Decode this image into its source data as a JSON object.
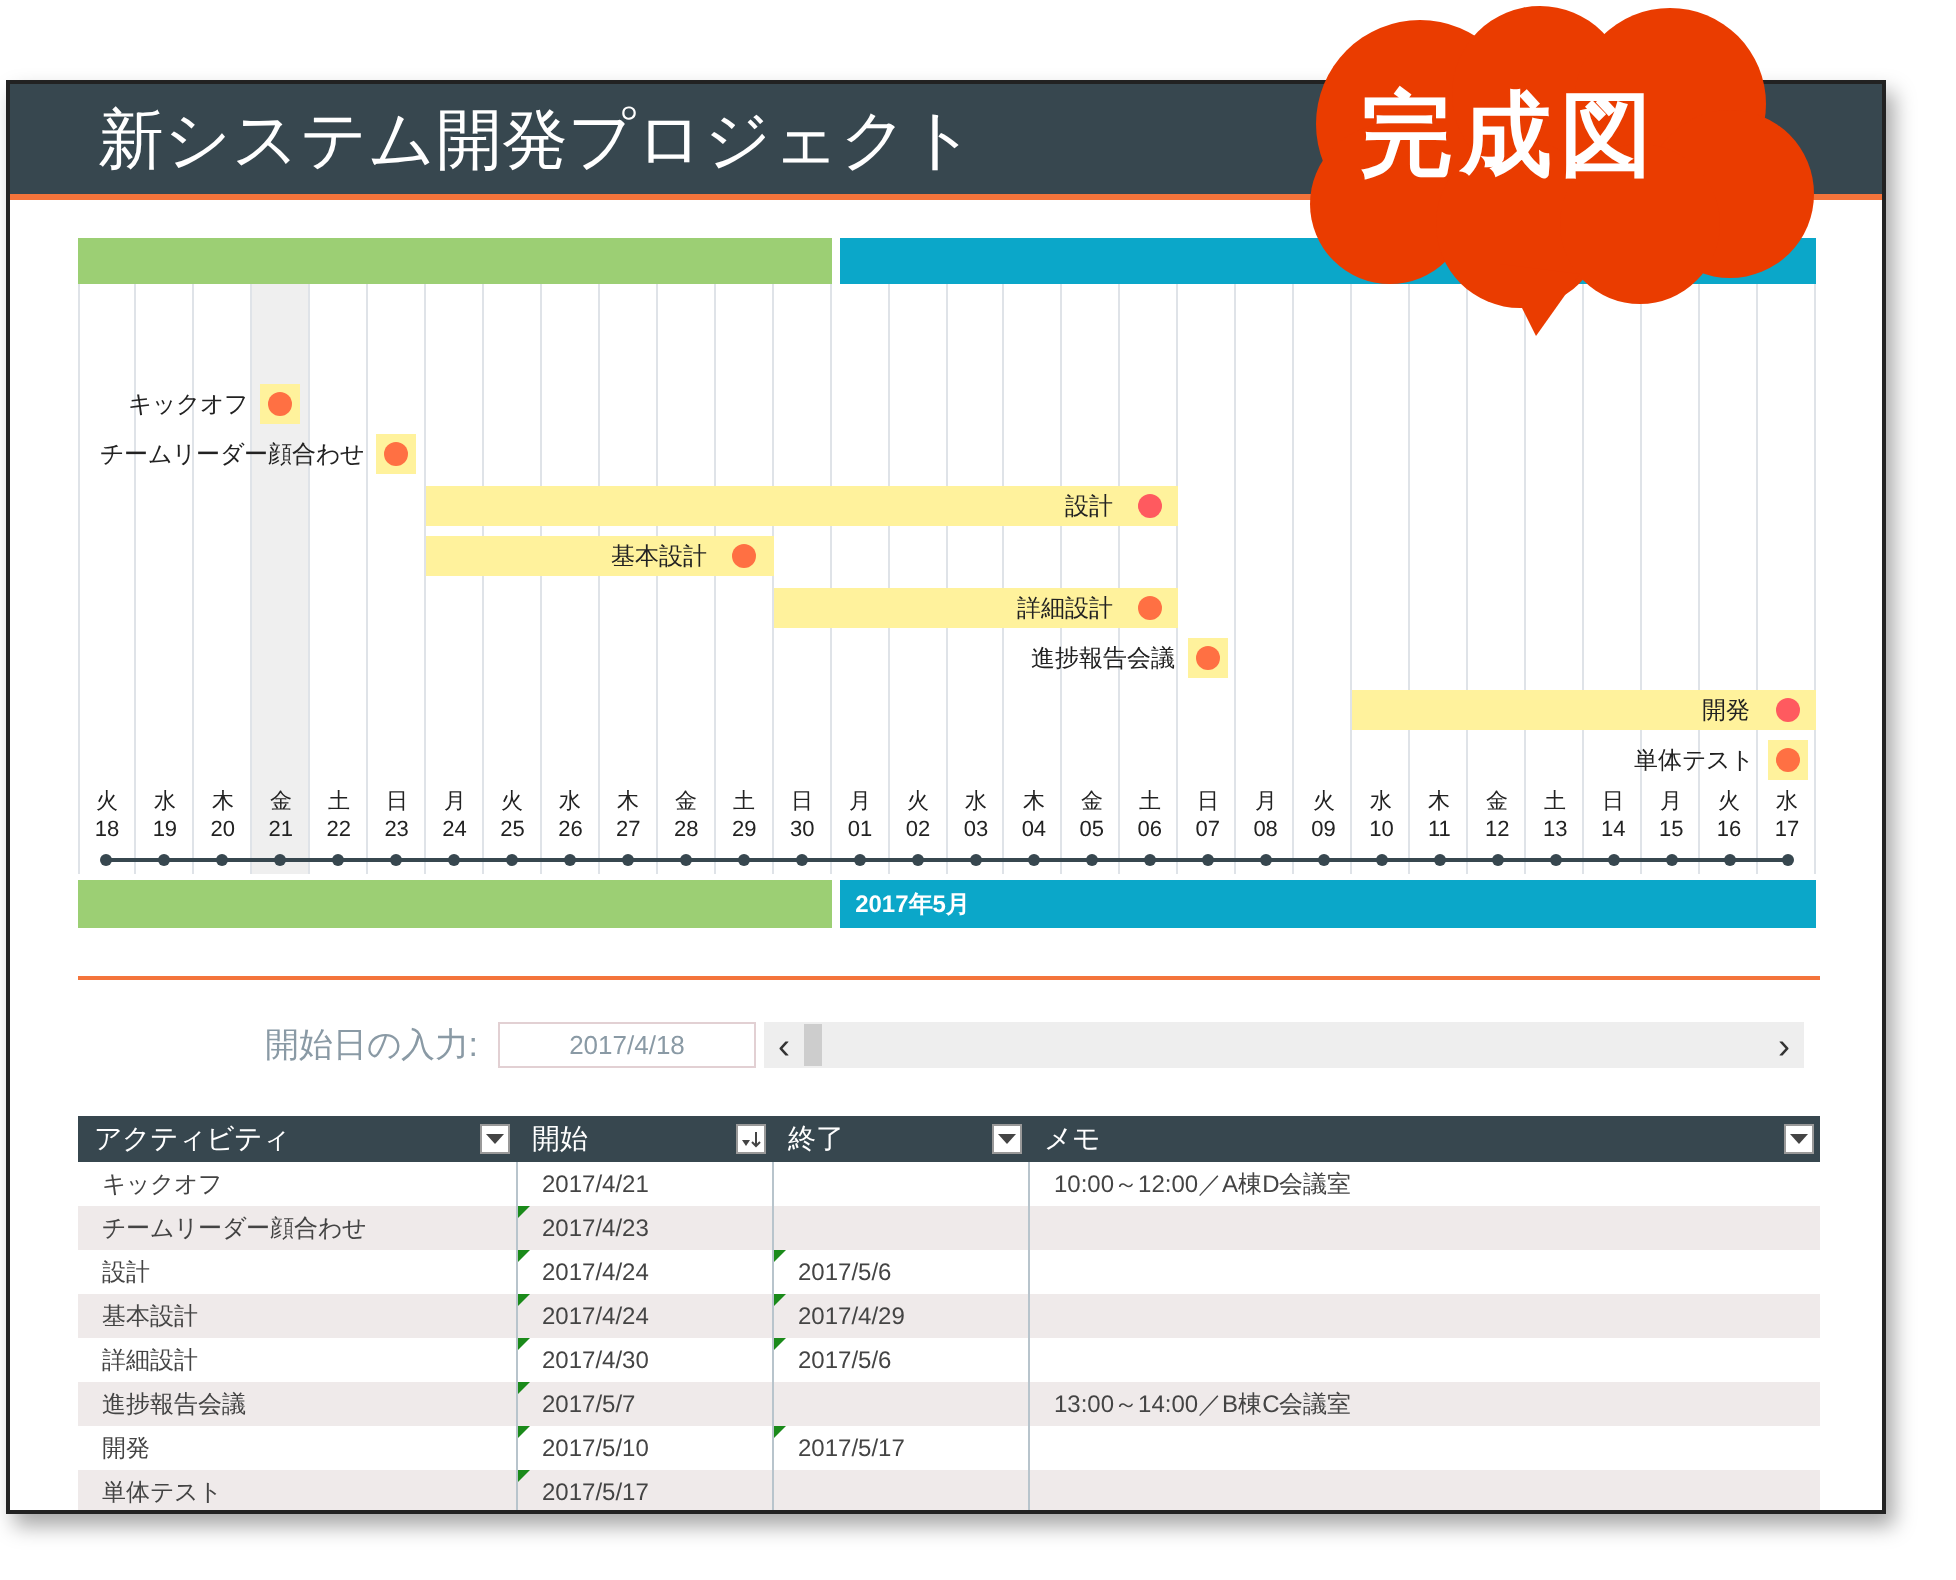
{
  "title": "新システム開発プロジェクト",
  "stamp": {
    "text": "完成図"
  },
  "months": [
    {
      "color": "#9ccf74"
    },
    {
      "color": "#0ba7c9",
      "label": "2017年5月"
    }
  ],
  "days": [
    {
      "weekday": "火",
      "day": "18",
      "highlighted": false
    },
    {
      "weekday": "水",
      "day": "19",
      "highlighted": false
    },
    {
      "weekday": "木",
      "day": "20",
      "highlighted": false
    },
    {
      "weekday": "金",
      "day": "21",
      "highlighted": true
    },
    {
      "weekday": "土",
      "day": "22",
      "highlighted": false
    },
    {
      "weekday": "日",
      "day": "23",
      "highlighted": false
    },
    {
      "weekday": "月",
      "day": "24",
      "highlighted": false
    },
    {
      "weekday": "火",
      "day": "25",
      "highlighted": false
    },
    {
      "weekday": "水",
      "day": "26",
      "highlighted": false
    },
    {
      "weekday": "木",
      "day": "27",
      "highlighted": false
    },
    {
      "weekday": "金",
      "day": "28",
      "highlighted": false
    },
    {
      "weekday": "土",
      "day": "29",
      "highlighted": false
    },
    {
      "weekday": "日",
      "day": "30",
      "highlighted": false
    },
    {
      "weekday": "月",
      "day": "01",
      "highlighted": false
    },
    {
      "weekday": "火",
      "day": "02",
      "highlighted": false
    },
    {
      "weekday": "水",
      "day": "03",
      "highlighted": false
    },
    {
      "weekday": "木",
      "day": "04",
      "highlighted": false
    },
    {
      "weekday": "金",
      "day": "05",
      "highlighted": false
    },
    {
      "weekday": "土",
      "day": "06",
      "highlighted": false
    },
    {
      "weekday": "日",
      "day": "07",
      "highlighted": false
    },
    {
      "weekday": "月",
      "day": "08",
      "highlighted": false
    },
    {
      "weekday": "火",
      "day": "09",
      "highlighted": false
    },
    {
      "weekday": "水",
      "day": "10",
      "highlighted": false
    },
    {
      "weekday": "木",
      "day": "11",
      "highlighted": false
    },
    {
      "weekday": "金",
      "day": "12",
      "highlighted": false
    },
    {
      "weekday": "土",
      "day": "13",
      "highlighted": false
    },
    {
      "weekday": "日",
      "day": "14",
      "highlighted": false
    },
    {
      "weekday": "月",
      "day": "15",
      "highlighted": false
    },
    {
      "weekday": "火",
      "day": "16",
      "highlighted": false
    },
    {
      "weekday": "水",
      "day": "17",
      "highlighted": false
    }
  ],
  "tasks": [
    {
      "label": "キックオフ",
      "kind": "milestone",
      "color": "#ff7043"
    },
    {
      "label": "チームリーダー顔合わせ",
      "kind": "milestone",
      "color": "#ff7043"
    },
    {
      "label": "設計",
      "kind": "bar",
      "color": "#ff5a5f"
    },
    {
      "label": "基本設計",
      "kind": "bar",
      "color": "#ff7043"
    },
    {
      "label": "詳細設計",
      "kind": "bar",
      "color": "#ff7043"
    },
    {
      "label": "進捗報告会議",
      "kind": "milestone",
      "color": "#ff7043"
    },
    {
      "label": "開発",
      "kind": "bar",
      "color": "#ff5a5f"
    },
    {
      "label": "単体テスト",
      "kind": "milestone",
      "color": "#ff7043"
    }
  ],
  "start_input": {
    "label": "開始日の入力:",
    "value": "2017/4/18",
    "left_arrow": "‹",
    "right_arrow": "›"
  },
  "table": {
    "columns": [
      {
        "label": "アクティビティ",
        "sorted": false
      },
      {
        "label": "開始",
        "sorted": true
      },
      {
        "label": "終了",
        "sorted": false
      },
      {
        "label": "メモ",
        "sorted": false
      }
    ],
    "rows": [
      {
        "activity": "キックオフ",
        "start": "2017/4/21",
        "start_flag": false,
        "memo": "10:00～12:00／A棟D会議室"
      },
      {
        "activity": "チームリーダー顔合わせ",
        "start": "2017/4/23",
        "start_flag": true
      },
      {
        "activity": "設計",
        "start": "2017/4/24",
        "start_flag": true,
        "end": "2017/5/6",
        "end_flag": true
      },
      {
        "activity": "基本設計",
        "start": "2017/4/24",
        "start_flag": true,
        "end": "2017/4/29",
        "end_flag": true
      },
      {
        "activity": "詳細設計",
        "start": "2017/4/30",
        "start_flag": true,
        "end": "2017/5/6",
        "end_flag": true
      },
      {
        "activity": "進捗報告会議",
        "start": "2017/5/7",
        "start_flag": true,
        "memo": "13:00～14:00／B棟C会議室"
      },
      {
        "activity": "開発",
        "start": "2017/5/10",
        "start_flag": true,
        "end": "2017/5/17",
        "end_flag": true
      },
      {
        "activity": "単体テスト",
        "start": "2017/5/17",
        "start_flag": true
      }
    ]
  }
}
